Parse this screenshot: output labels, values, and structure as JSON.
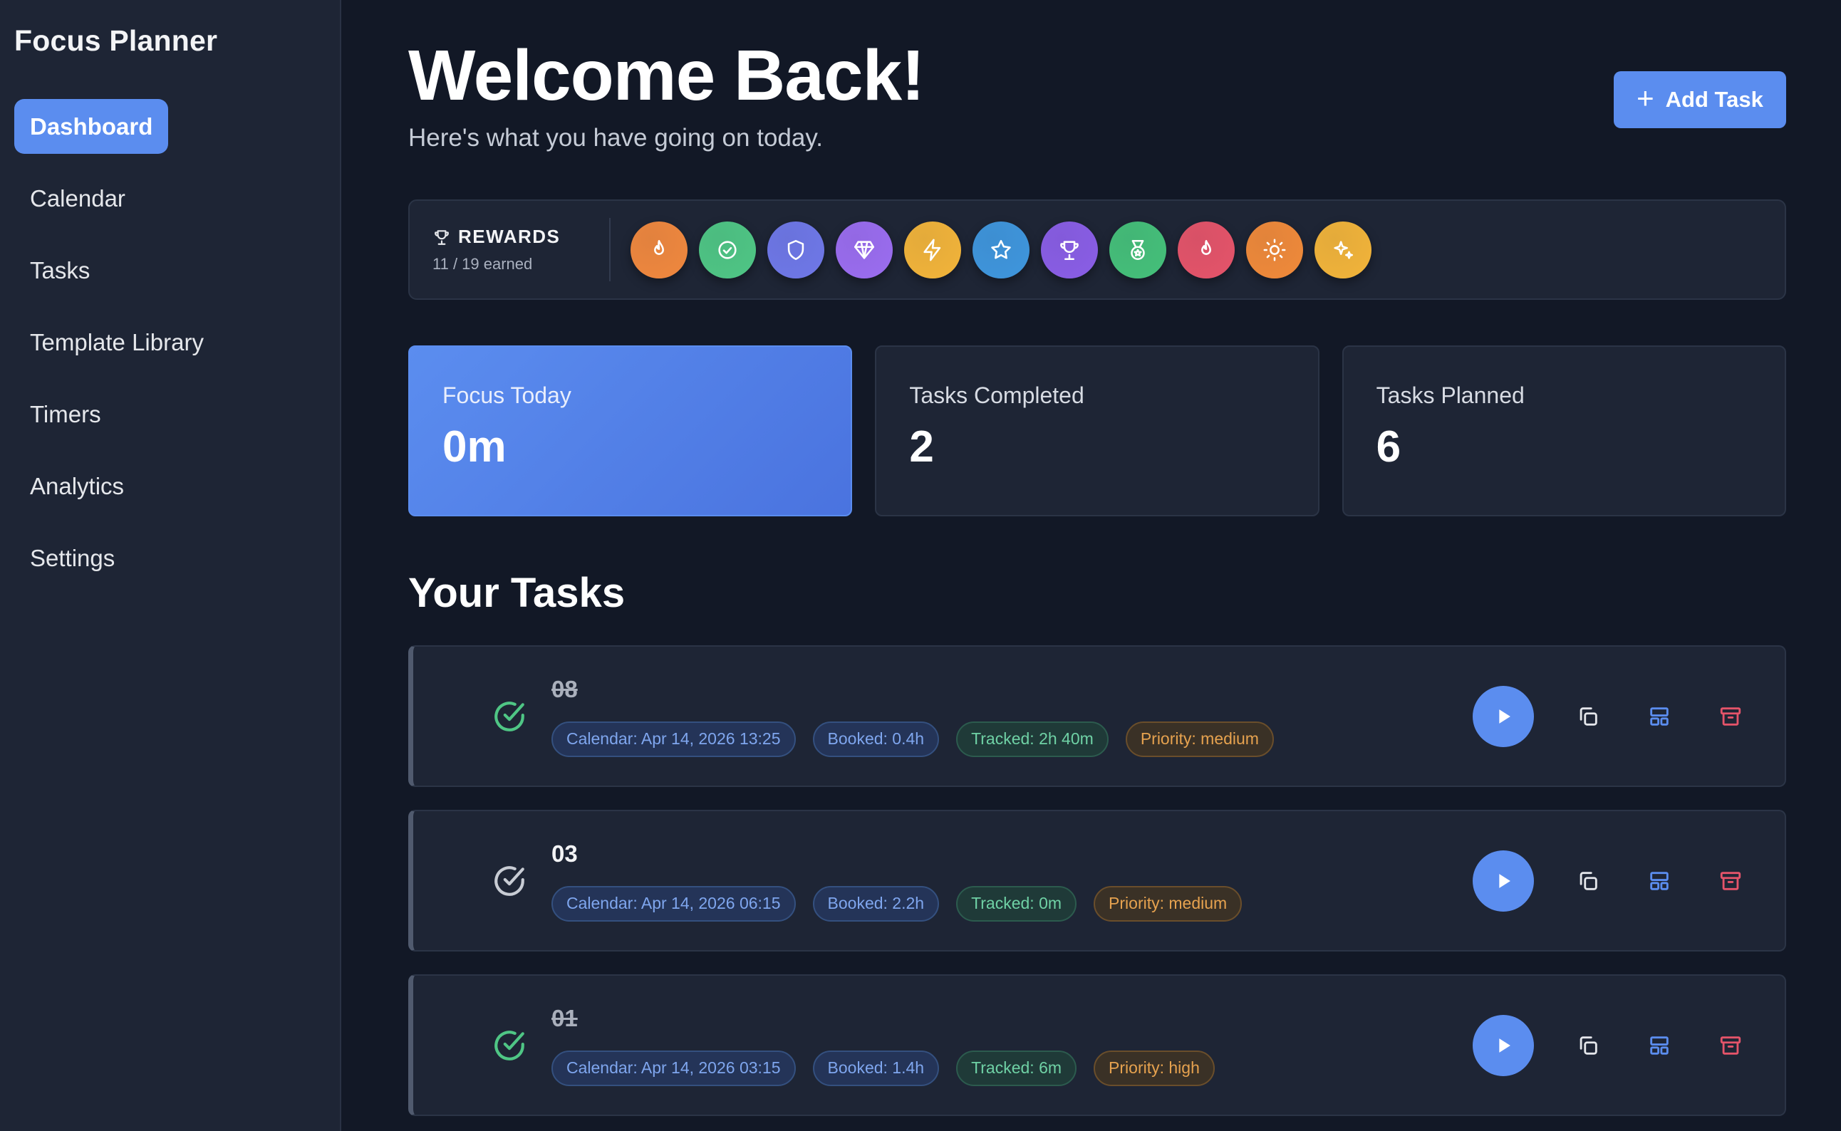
{
  "sidebar": {
    "brand": "Focus Planner",
    "items": [
      {
        "label": "Dashboard",
        "active": true
      },
      {
        "label": "Calendar"
      },
      {
        "label": "Tasks"
      },
      {
        "label": "Template Library"
      },
      {
        "label": "Timers"
      },
      {
        "label": "Analytics"
      },
      {
        "label": "Settings"
      }
    ]
  },
  "header": {
    "title": "Welcome Back!",
    "subtitle": "Here's what you have going on today.",
    "add_task_label": "Add Task"
  },
  "rewards": {
    "title": "REWARDS",
    "count": "11 / 19 earned",
    "badges": [
      {
        "icon": "flame-icon",
        "color": "#f0883e"
      },
      {
        "icon": "check-circle-icon",
        "color": "#4fc685"
      },
      {
        "icon": "shield-icon",
        "color": "#6f78e8"
      },
      {
        "icon": "diamond-icon",
        "color": "#9b6df0"
      },
      {
        "icon": "lightning-icon",
        "color": "#f2b43a"
      },
      {
        "icon": "star-icon",
        "color": "#3f96dd"
      },
      {
        "icon": "trophy-icon",
        "color": "#8a5ee6"
      },
      {
        "icon": "medal-icon",
        "color": "#45c07a"
      },
      {
        "icon": "flame-icon",
        "color": "#e5546a"
      },
      {
        "icon": "sun-icon",
        "color": "#f08a3a"
      },
      {
        "icon": "sparkles-icon",
        "color": "#f2b43a"
      }
    ]
  },
  "stats": [
    {
      "label": "Focus Today",
      "value": "0m"
    },
    {
      "label": "Tasks Completed",
      "value": "2"
    },
    {
      "label": "Tasks Planned",
      "value": "6"
    }
  ],
  "tasks_section": {
    "title": "Your Tasks"
  },
  "tasks": [
    {
      "title": "08",
      "done": true,
      "calendar": "Calendar: Apr 14, 2026 13:25",
      "booked": "Booked: 0.4h",
      "tracked": "Tracked: 2h 40m",
      "priority": "Priority: medium"
    },
    {
      "title": "03",
      "done": false,
      "calendar": "Calendar: Apr 14, 2026 06:15",
      "booked": "Booked: 2.2h",
      "tracked": "Tracked: 0m",
      "priority": "Priority: medium"
    },
    {
      "title": "01",
      "done": true,
      "calendar": "Calendar: Apr 14, 2026 03:15",
      "booked": "Booked: 1.4h",
      "tracked": "Tracked: 6m",
      "priority": "Priority: high"
    }
  ],
  "colors": {
    "accent": "#5b8def",
    "done_check": "#4fc685",
    "open_check": "#c8ccd4",
    "delete": "#e5546a"
  }
}
